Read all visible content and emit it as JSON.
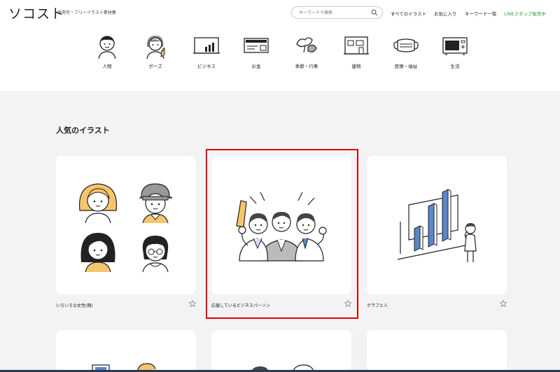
{
  "header": {
    "logo": "ソコスト",
    "tagline": "商用可・フリーイラスト素材集",
    "search_placeholder": "キーワードで検索",
    "nav": [
      {
        "label": "すべてのイラスト"
      },
      {
        "label": "お気に入り"
      },
      {
        "label": "キーワード一覧"
      },
      {
        "label": "LINEスタンプ販売中"
      }
    ]
  },
  "categories": [
    {
      "label": "人物",
      "icon": "person-icon"
    },
    {
      "label": "ポーズ",
      "icon": "pose-icon"
    },
    {
      "label": "ビジネス",
      "icon": "business-chart-icon"
    },
    {
      "label": "お金",
      "icon": "money-icon"
    },
    {
      "label": "季節・行事",
      "icon": "season-icon"
    },
    {
      "label": "建物",
      "icon": "building-icon"
    },
    {
      "label": "医療・福祉",
      "icon": "medical-mask-icon"
    },
    {
      "label": "生活",
      "icon": "microwave-icon"
    }
  ],
  "section": {
    "title": "人気のイラスト"
  },
  "cards": [
    {
      "title": "いろいろな女性(顔)",
      "icon": "women-faces-illustration"
    },
    {
      "title": "応援しているビジネスパーソン",
      "icon": "cheering-business-people-illustration"
    },
    {
      "title": "グラフと人",
      "icon": "graph-and-person-illustration"
    }
  ],
  "colors": {
    "accent_green": "#2e9e3a",
    "highlight_red": "#e00000",
    "chart_blue": "#5b86c8"
  }
}
